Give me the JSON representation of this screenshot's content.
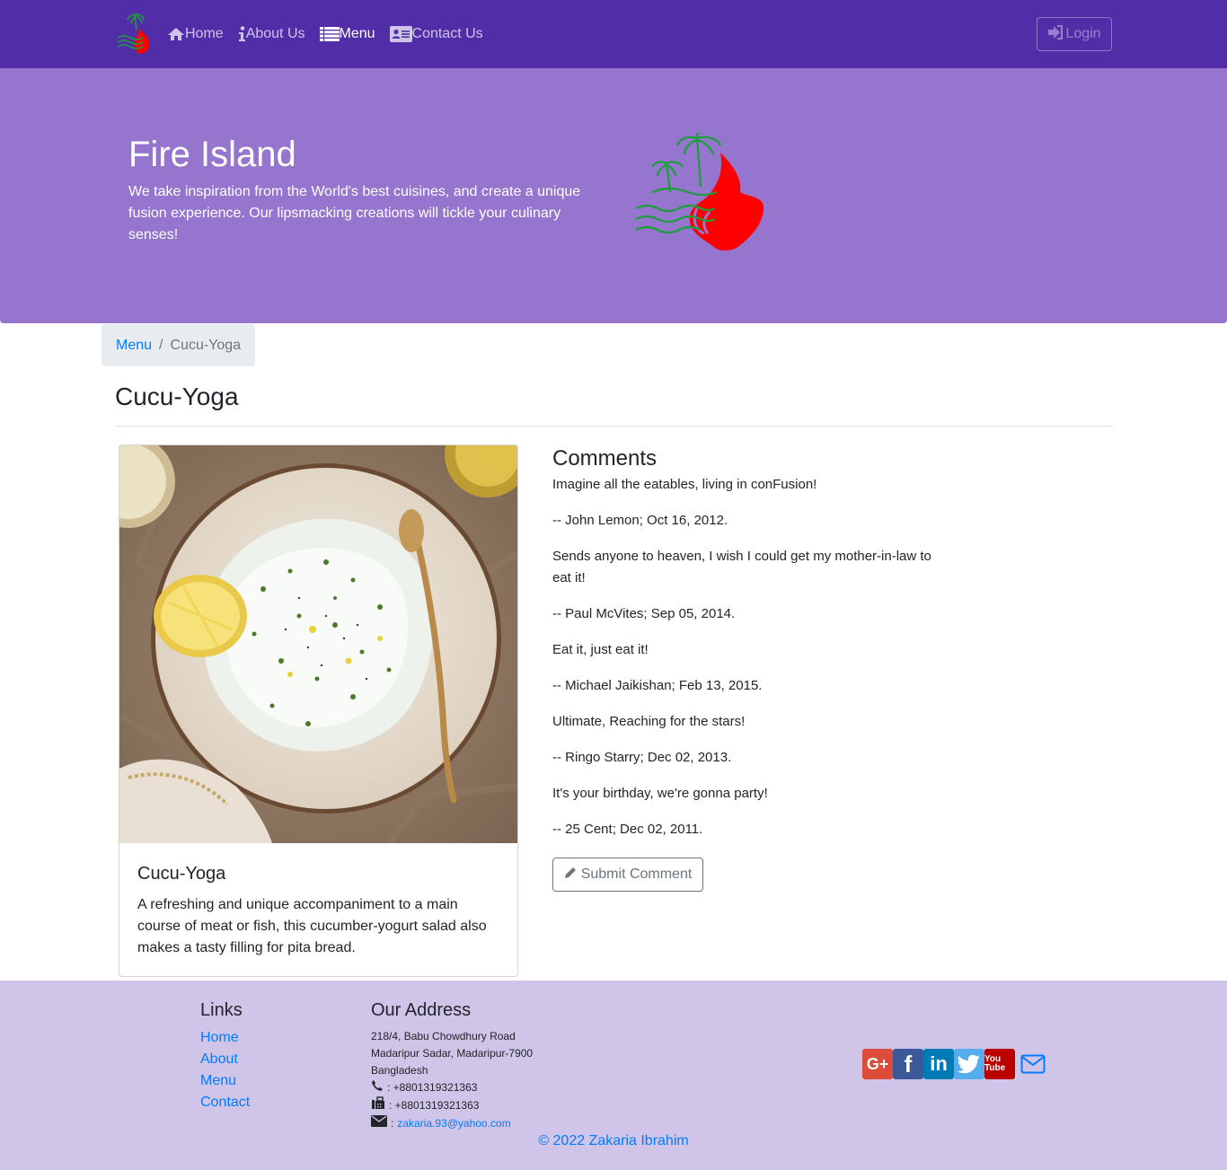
{
  "nav": {
    "items": [
      {
        "label": "Home",
        "icon": "home-icon"
      },
      {
        "label": "About Us",
        "icon": "info-icon"
      },
      {
        "label": "Menu",
        "icon": "list-icon"
      },
      {
        "label": "Contact Us",
        "icon": "address-card-icon"
      }
    ],
    "active": "Menu",
    "login_label": "Login"
  },
  "jumbotron": {
    "title": "Fire Island",
    "text": "We take inspiration from the World's best cuisines, and create a unique fusion experience. Our lipsmacking creations will tickle your culinary senses!"
  },
  "breadcrumb": {
    "link": "Menu",
    "separator": "/",
    "current": "Cucu-Yoga"
  },
  "page": {
    "heading": "Cucu-Yoga"
  },
  "dish": {
    "name": "Cucu-Yoga",
    "description": "A refreshing and unique accompaniment to a main course of meat or fish, this cucumber-yogurt salad also makes a tasty filling for pita bread."
  },
  "comments": {
    "title": "Comments",
    "items": [
      {
        "text": "Imagine all the eatables, living in conFusion!",
        "author": "-- John Lemon; Oct 16, 2012."
      },
      {
        "text": "Sends anyone to heaven, I wish I could get my mother-in-law to eat it!",
        "author": "-- Paul McVites; Sep 05, 2014."
      },
      {
        "text": "Eat it, just eat it!",
        "author": "-- Michael Jaikishan; Feb 13, 2015."
      },
      {
        "text": "Ultimate, Reaching for the stars!",
        "author": "-- Ringo Starry; Dec 02, 2013."
      },
      {
        "text": "It's your birthday, we're gonna party!",
        "author": "-- 25 Cent; Dec 02, 2011."
      }
    ],
    "submit_label": "Submit Comment"
  },
  "footer": {
    "links_title": "Links",
    "links": [
      "Home",
      "About",
      "Menu",
      "Contact"
    ],
    "address_title": "Our Address",
    "address_lines": [
      "218/4, Babu Chowdhury Road",
      "Madaripur Sadar, Madaripur-7900",
      "Bangladesh"
    ],
    "phone": ": +8801319321363",
    "fax": ": +8801319321363",
    "email_prefix": ":",
    "email": "zakaria.93@yahoo.com",
    "social": [
      {
        "icon": "google-plus-icon",
        "label": "G+",
        "color": "#dd4b39"
      },
      {
        "icon": "facebook-icon",
        "label": "f",
        "color": "#3b5998"
      },
      {
        "icon": "linkedin-icon",
        "label": "in",
        "color": "#007bb6"
      },
      {
        "icon": "twitter-icon",
        "label": "",
        "color": "#55acee"
      },
      {
        "icon": "youtube-icon",
        "label": "You Tube",
        "color": "#bb0000"
      },
      {
        "icon": "envelope-icon",
        "label": "",
        "color": "#007bff"
      }
    ],
    "copyright": "© 2022 Zakaria Ibrahim"
  },
  "colors": {
    "navbar": "#512da8",
    "jumbotron": "#9575cd",
    "footer": "#d1c4e9",
    "link": "#007bff"
  }
}
